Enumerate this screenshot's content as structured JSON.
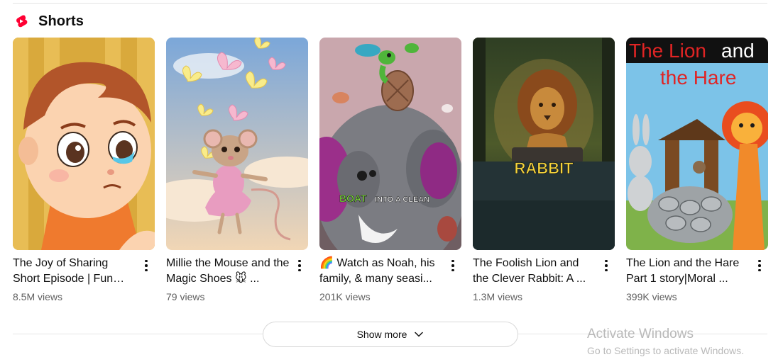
{
  "section": {
    "title": "Shorts",
    "icon": "youtube-shorts-icon"
  },
  "cards": [
    {
      "title": "The Joy of Sharing Short Episode |  Fun Learning For Kids",
      "views": "8.5M views",
      "thumbnail_icon": "cartoon-boy-crying"
    },
    {
      "title": "Millie the Mouse and the Magic Shoes 🐭 ...",
      "views": "79 views",
      "thumbnail_icon": "mouse-with-butterflies"
    },
    {
      "title": "🌈 Watch as Noah, his family, & many seasi...",
      "views": "201K views",
      "thumbnail_icon": "elephant-and-turtle",
      "overlay_text_a": "BOAT",
      "overlay_text_b": "INTO A CLEAN"
    },
    {
      "title": "The Foolish Lion and the Clever Rabbit: A ...",
      "views": "1.3M views",
      "thumbnail_icon": "lion-on-rock",
      "overlay_text": "RABBIT"
    },
    {
      "title": "The Lion and the Hare Part 1 story|Moral ...",
      "views": "399K views",
      "thumbnail_icon": "lion-and-hare-well",
      "overlay_line1_a": "The Lion",
      "overlay_line1_b": "and",
      "overlay_line2": "the Hare"
    }
  ],
  "show_more": {
    "label": "Show more",
    "icon": "chevron-down-icon"
  },
  "watermark": {
    "title": "Activate Windows",
    "subtitle": "Go to Settings to activate Windows."
  },
  "colors": {
    "shorts_red": "#ff0033",
    "text_primary": "#0f0f0f",
    "text_secondary": "#606060"
  }
}
